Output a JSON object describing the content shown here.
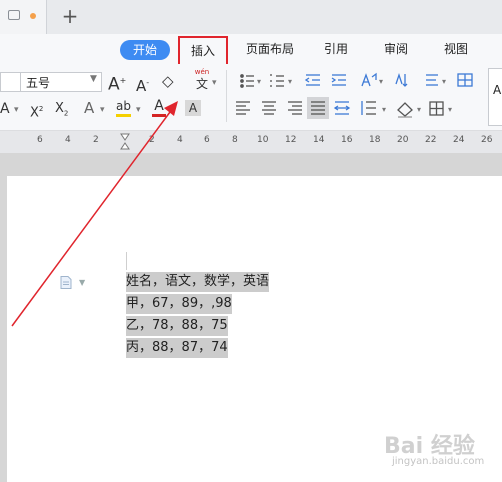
{
  "tabs": {
    "new_tab_symbol": "+"
  },
  "menu": {
    "start": "开始",
    "insert": "插入",
    "page_layout": "页面布局",
    "references": "引用",
    "review": "审阅",
    "view": "视图"
  },
  "toolbar": {
    "font_size": "五号",
    "increase_font": "A",
    "decrease_font": "A",
    "clear_format": "◇",
    "pinyin_top": "wén",
    "pinyin_bottom": "文",
    "italic_a": "A",
    "superscript": "X",
    "superscript_mark": "2",
    "subscript": "X",
    "subscript_mark": "2",
    "outline_a": "A",
    "highlight": "ab",
    "font_color": "A",
    "char_shade": "A",
    "style_preview": "Aa"
  },
  "ruler": {
    "numbers": [
      "6",
      "4",
      "2",
      "2",
      "4",
      "6",
      "8",
      "10",
      "12",
      "14",
      "16",
      "18",
      "20",
      "22",
      "24",
      "26"
    ]
  },
  "document": {
    "lines": [
      "姓名，语文，数学，英语",
      "甲，67，89，,98",
      "乙，78，88，75",
      "丙，88，87，74"
    ]
  },
  "watermark": {
    "brand": "Bai 经验",
    "url": "jingyan.baidu.com"
  },
  "colors": {
    "accent": "#3d8bf2",
    "annotation_red": "#e0252d",
    "selection": "#cccccc"
  }
}
